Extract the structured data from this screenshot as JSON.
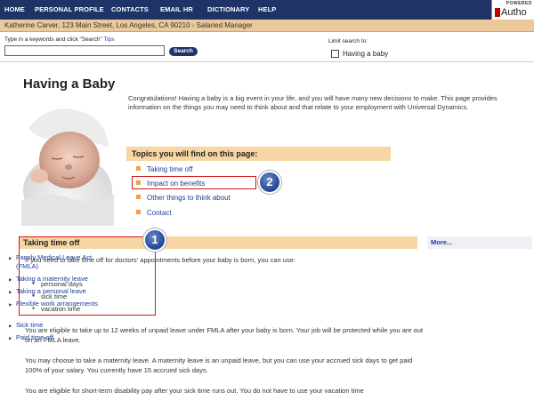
{
  "nav": {
    "items": [
      "HOME",
      "PERSONAL PROFILE",
      "CONTACTS",
      "EMAIL HR",
      "DICTIONARY",
      "HELP"
    ],
    "logo_powered": "POWERED",
    "logo_text": "Autho"
  },
  "user_bar": {
    "text": "Katherine Carver, 123 Main Street, Los Angeles, CA 90210 - Salaried Manager"
  },
  "search": {
    "label": "Type in a keywords and click \"Search\"",
    "tips": "Tips",
    "button": "Search",
    "limit_label": "Limit search to:",
    "limit_option": "Having a baby"
  },
  "page": {
    "title": "Having a Baby",
    "intro": "Congratulations! Having a baby is a big event in your life, and you will have many new decisions to make. This page provides information on the things you may need to think about and that relate to your employment with Universal Dynamics."
  },
  "topics": {
    "header": "Topics you will find on this page:",
    "items": [
      "Taking time off",
      "Impact on benefits",
      "Other things to think about",
      "Contact"
    ]
  },
  "annotations": {
    "badge_1": "1",
    "badge_2": "2"
  },
  "section": {
    "header": "Taking time off",
    "lead": "If you need to take time off for doctors' appointments before your baby is born, you can use:",
    "leave_types": [
      "personal days",
      "sick time",
      "vacation time"
    ],
    "paragraphs": [
      "You are eligible to take up to 12 weeks of unpaid leave under FMLA after your baby is born. Your job will be protected while you are out on an FMLA leave.",
      "You may choose to take a maternity leave. A maternity leave is an unpaid leave, but you can use your accrued sick days to get paid 100% of your salary. You currently have 15 accrued sick days.",
      "You are eligible for short-term disability pay after your sick time runs out. You do not have to use your vacation time"
    ]
  },
  "more": {
    "header": "More...",
    "links": [
      "Family Medical Leave Act (FMLA)",
      "Taking a maternity leave",
      "Taking a personal leave",
      "Flexible work arrangements",
      "Sick time",
      "Paid time-off"
    ]
  },
  "colors": {
    "nav_bg": "#1f3466",
    "user_bar_bg": "#ecc99a",
    "section_header_bg": "#f7d6a3",
    "link": "#1a3d9a",
    "annotation_red": "#d01818",
    "badge_blue": "#2a4e9c"
  }
}
